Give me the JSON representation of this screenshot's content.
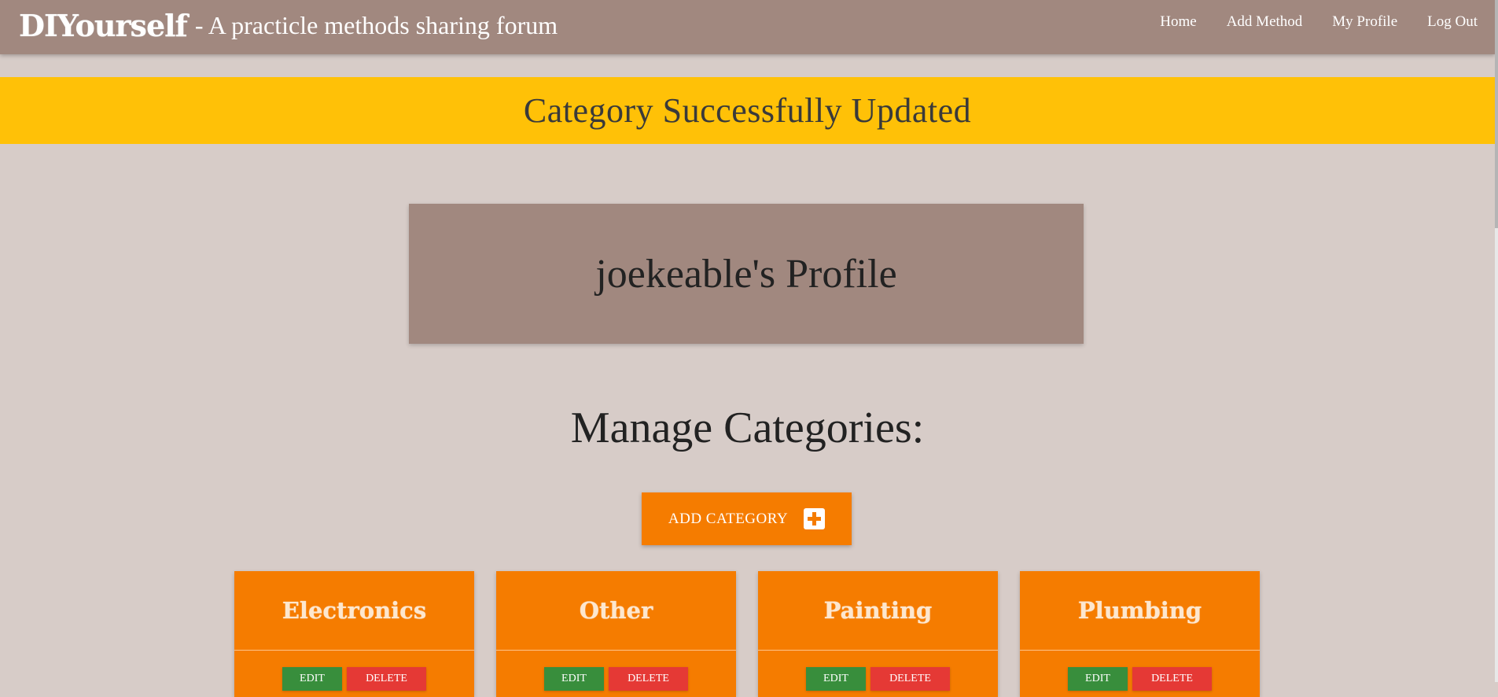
{
  "navbar": {
    "brand": "DIYourself",
    "tagline": "- A practicle methods sharing forum",
    "links": [
      "Home",
      "Add Method",
      "My Profile",
      "Log Out"
    ]
  },
  "flash": {
    "message": "Category Successfully Updated"
  },
  "profile": {
    "title": "joekeable's Profile"
  },
  "manage": {
    "title": "Manage Categories:",
    "add_label": "ADD CATEGORY",
    "add_icon": "plus-box-icon"
  },
  "categories": [
    {
      "name": "Electronics",
      "edit_label": "EDIT",
      "delete_label": "DELETE"
    },
    {
      "name": "Other",
      "edit_label": "EDIT",
      "delete_label": "DELETE"
    },
    {
      "name": "Painting",
      "edit_label": "EDIT",
      "delete_label": "DELETE"
    },
    {
      "name": "Plumbing",
      "edit_label": "EDIT",
      "delete_label": "DELETE"
    }
  ],
  "colors": {
    "navbar": "#a1887f",
    "background": "#d7ccc8",
    "flash": "#ffc107",
    "accent": "#f57c00",
    "edit": "#388e3c",
    "delete": "#e53935"
  }
}
